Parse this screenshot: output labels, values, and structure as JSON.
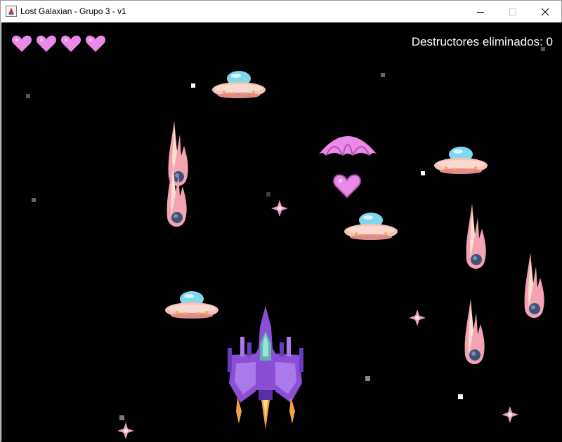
{
  "window": {
    "title": "Lost Galaxian - Grupo 3 - v1"
  },
  "hud": {
    "lives": 4,
    "score_text": "Destructores eliminados: 0"
  },
  "colors": {
    "background": "#000000",
    "heart": "#e98ae6",
    "ufo_dome": "#7fd8ee",
    "ufo_body": "#f6c3b8",
    "ship": "#8a4fd6",
    "meteor": "#f4a3b2",
    "sparkle": "#e9a0c8"
  },
  "sprites": {
    "ufo": "ufo-enemy-icon",
    "meteor": "meteor-icon",
    "parachute": "parachute-powerup-icon",
    "heart": "heart-pickup-icon",
    "player": "player-spaceship-icon",
    "sparkle": "sparkle-star-icon"
  }
}
